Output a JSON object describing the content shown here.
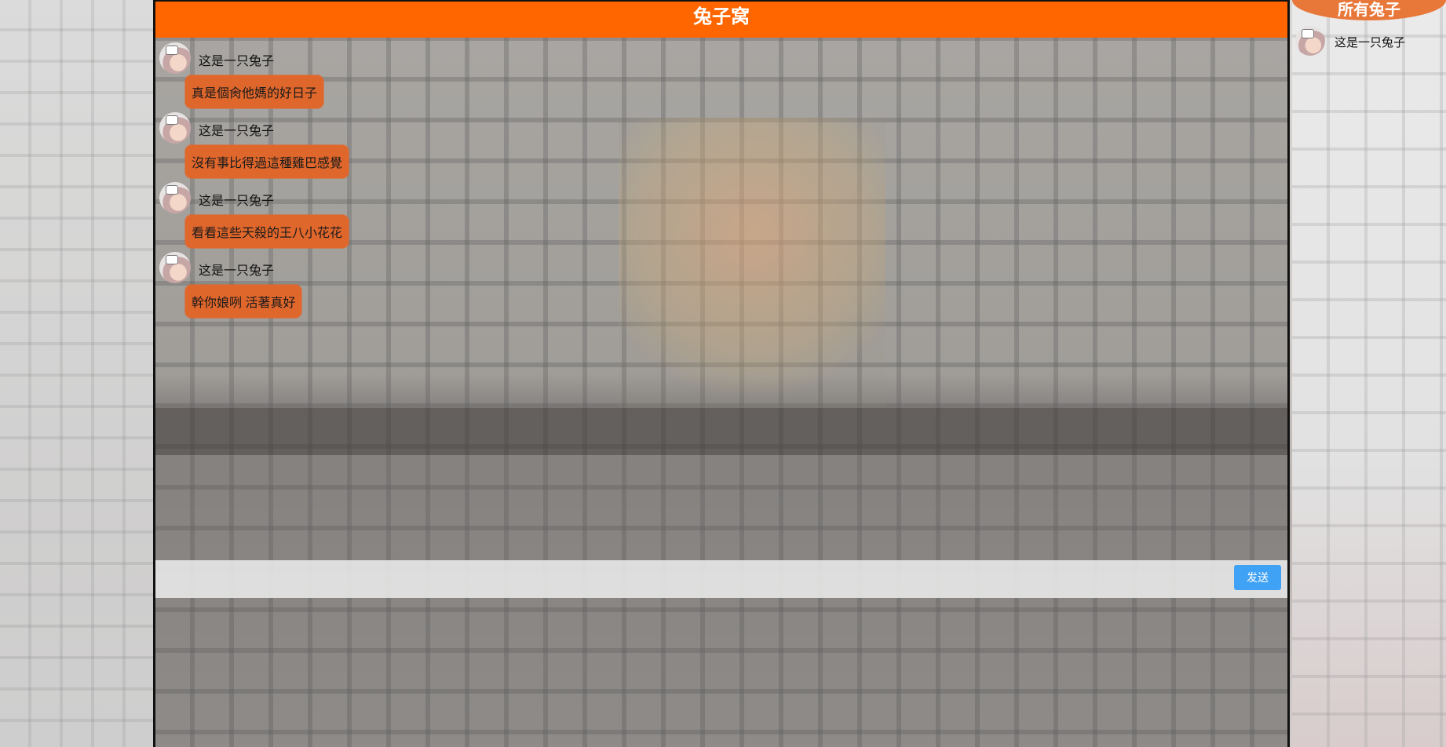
{
  "chat": {
    "title": "兔子窝",
    "messages": [
      {
        "user": "这是一只兔子",
        "text": "真是個肏他媽的好日子"
      },
      {
        "user": "这是一只兔子",
        "text": "沒有事比得過這種雞巴感覺"
      },
      {
        "user": "这是一只兔子",
        "text": "看看這些天殺的王八小花花"
      },
      {
        "user": "这是一只兔子",
        "text": "幹你娘咧 活著真好"
      }
    ],
    "input": {
      "value": "",
      "placeholder": ""
    },
    "send_label": "发送"
  },
  "user_panel": {
    "title": "所有兔子",
    "users": [
      {
        "name": "这是一只兔子"
      }
    ]
  },
  "colors": {
    "header": "#ff6600",
    "bubble": "#e0672c",
    "send_button": "#40a2f5",
    "panel_title": "#e8773a"
  },
  "icons": {
    "avatar": "rabbit-avatar-icon"
  }
}
